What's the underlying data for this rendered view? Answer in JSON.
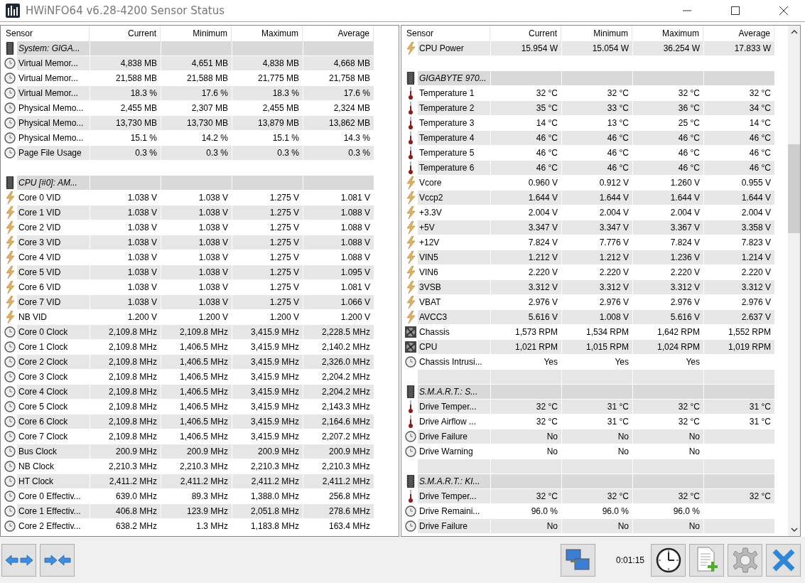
{
  "window": {
    "title": "HWiNFO64 v6.28-4200 Sensor Status"
  },
  "panels": [
    {
      "columns": [
        "Sensor",
        "Current",
        "Minimum",
        "Maximum",
        "Average"
      ],
      "rows": [
        {
          "kind": "group",
          "name": "System: GIGA..."
        },
        {
          "kind": "usage",
          "name": "Virtual Memor...",
          "values": [
            "4,838 MB",
            "4,651 MB",
            "4,838 MB",
            "4,668 MB"
          ],
          "shaded": true
        },
        {
          "kind": "usage",
          "name": "Virtual Memor...",
          "values": [
            "21,588 MB",
            "21,588 MB",
            "21,775 MB",
            "21,758 MB"
          ],
          "shaded": false
        },
        {
          "kind": "usage",
          "name": "Virtual Memor...",
          "values": [
            "18.3 %",
            "17.6 %",
            "18.3 %",
            "17.6 %"
          ],
          "shaded": true
        },
        {
          "kind": "usage",
          "name": "Physical Memo...",
          "values": [
            "2,455 MB",
            "2,307 MB",
            "2,455 MB",
            "2,324 MB"
          ],
          "shaded": false
        },
        {
          "kind": "usage",
          "name": "Physical Memo...",
          "values": [
            "13,730 MB",
            "13,730 MB",
            "13,879 MB",
            "13,862 MB"
          ],
          "shaded": true
        },
        {
          "kind": "usage",
          "name": "Physical Memo...",
          "values": [
            "15.1 %",
            "14.2 %",
            "15.1 %",
            "14.3 %"
          ],
          "shaded": false
        },
        {
          "kind": "usage",
          "name": "Page File Usage",
          "values": [
            "0.3 %",
            "0.3 %",
            "0.3 %",
            "0.3 %"
          ],
          "shaded": true
        },
        {
          "kind": "blank",
          "shaded": false
        },
        {
          "kind": "group",
          "name": "CPU [#0]: AM..."
        },
        {
          "kind": "voltage",
          "name": "Core 0 VID",
          "values": [
            "1.038 V",
            "1.038 V",
            "1.275 V",
            "1.081 V"
          ],
          "shaded": false
        },
        {
          "kind": "voltage",
          "name": "Core 1 VID",
          "values": [
            "1.038 V",
            "1.038 V",
            "1.275 V",
            "1.088 V"
          ],
          "shaded": true
        },
        {
          "kind": "voltage",
          "name": "Core 2 VID",
          "values": [
            "1.038 V",
            "1.038 V",
            "1.275 V",
            "1.088 V"
          ],
          "shaded": false
        },
        {
          "kind": "voltage",
          "name": "Core 3 VID",
          "values": [
            "1.038 V",
            "1.038 V",
            "1.275 V",
            "1.088 V"
          ],
          "shaded": true
        },
        {
          "kind": "voltage",
          "name": "Core 4 VID",
          "values": [
            "1.038 V",
            "1.038 V",
            "1.275 V",
            "1.088 V"
          ],
          "shaded": false
        },
        {
          "kind": "voltage",
          "name": "Core 5 VID",
          "values": [
            "1.038 V",
            "1.038 V",
            "1.275 V",
            "1.095 V"
          ],
          "shaded": true
        },
        {
          "kind": "voltage",
          "name": "Core 6 VID",
          "values": [
            "1.038 V",
            "1.038 V",
            "1.275 V",
            "1.081 V"
          ],
          "shaded": false
        },
        {
          "kind": "voltage",
          "name": "Core 7 VID",
          "values": [
            "1.038 V",
            "1.038 V",
            "1.275 V",
            "1.066 V"
          ],
          "shaded": true
        },
        {
          "kind": "voltage",
          "name": "NB VID",
          "values": [
            "1.200 V",
            "1.200 V",
            "1.200 V",
            "1.200 V"
          ],
          "shaded": false
        },
        {
          "kind": "usage",
          "name": "Core 0 Clock",
          "values": [
            "2,109.8 MHz",
            "2,109.8 MHz",
            "3,415.9 MHz",
            "2,228.5 MHz"
          ],
          "shaded": true
        },
        {
          "kind": "usage",
          "name": "Core 1 Clock",
          "values": [
            "2,109.8 MHz",
            "1,406.5 MHz",
            "3,415.9 MHz",
            "2,140.2 MHz"
          ],
          "shaded": false
        },
        {
          "kind": "usage",
          "name": "Core 2 Clock",
          "values": [
            "2,109.8 MHz",
            "1,406.5 MHz",
            "3,415.9 MHz",
            "2,326.0 MHz"
          ],
          "shaded": true
        },
        {
          "kind": "usage",
          "name": "Core 3 Clock",
          "values": [
            "2,109.8 MHz",
            "1,406.5 MHz",
            "3,415.9 MHz",
            "2,204.2 MHz"
          ],
          "shaded": false
        },
        {
          "kind": "usage",
          "name": "Core 4 Clock",
          "values": [
            "2,109.8 MHz",
            "1,406.5 MHz",
            "3,415.9 MHz",
            "2,204.2 MHz"
          ],
          "shaded": true
        },
        {
          "kind": "usage",
          "name": "Core 5 Clock",
          "values": [
            "2,109.8 MHz",
            "1,406.5 MHz",
            "3,415.9 MHz",
            "2,143.3 MHz"
          ],
          "shaded": false
        },
        {
          "kind": "usage",
          "name": "Core 6 Clock",
          "values": [
            "2,109.8 MHz",
            "1,406.5 MHz",
            "3,415.9 MHz",
            "2,164.6 MHz"
          ],
          "shaded": true
        },
        {
          "kind": "usage",
          "name": "Core 7 Clock",
          "values": [
            "2,109.8 MHz",
            "1,406.5 MHz",
            "3,415.9 MHz",
            "2,207.2 MHz"
          ],
          "shaded": false
        },
        {
          "kind": "usage",
          "name": "Bus Clock",
          "values": [
            "200.9 MHz",
            "200.9 MHz",
            "200.9 MHz",
            "200.9 MHz"
          ],
          "shaded": true
        },
        {
          "kind": "usage",
          "name": "NB Clock",
          "values": [
            "2,210.3 MHz",
            "2,210.3 MHz",
            "2,210.3 MHz",
            "2,210.3 MHz"
          ],
          "shaded": false
        },
        {
          "kind": "usage",
          "name": "HT Clock",
          "values": [
            "2,411.2 MHz",
            "2,411.2 MHz",
            "2,411.2 MHz",
            "2,411.2 MHz"
          ],
          "shaded": true
        },
        {
          "kind": "usage",
          "name": "Core 0 Effectiv...",
          "values": [
            "639.0 MHz",
            "89.3 MHz",
            "1,388.0 MHz",
            "256.8 MHz"
          ],
          "shaded": false
        },
        {
          "kind": "usage",
          "name": "Core 1 Effectiv...",
          "values": [
            "406.8 MHz",
            "123.9 MHz",
            "2,051.8 MHz",
            "278.6 MHz"
          ],
          "shaded": true
        },
        {
          "kind": "usage",
          "name": "Core 2 Effectiv...",
          "values": [
            "638.2 MHz",
            "1.3 MHz",
            "1,183.8 MHz",
            "163.4 MHz"
          ],
          "shaded": false
        }
      ]
    },
    {
      "columns": [
        "Sensor",
        "Current",
        "Minimum",
        "Maximum",
        "Average"
      ],
      "rows": [
        {
          "kind": "voltage",
          "name": "CPU Power",
          "values": [
            "15.954 W",
            "15.054 W",
            "36.254 W",
            "17.833 W"
          ],
          "shaded": true
        },
        {
          "kind": "blank",
          "shaded": false
        },
        {
          "kind": "group",
          "name": "GIGABYTE 970..."
        },
        {
          "kind": "temperature",
          "name": "Temperature 1",
          "values": [
            "32 °C",
            "32 °C",
            "32 °C",
            "32 °C"
          ],
          "shaded": false
        },
        {
          "kind": "temperature",
          "name": "Temperature 2",
          "values": [
            "35 °C",
            "33 °C",
            "36 °C",
            "34 °C"
          ],
          "shaded": true
        },
        {
          "kind": "temperature",
          "name": "Temperature 3",
          "values": [
            "14 °C",
            "13 °C",
            "25 °C",
            "14 °C"
          ],
          "shaded": false
        },
        {
          "kind": "temperature",
          "name": "Temperature 4",
          "values": [
            "46 °C",
            "46 °C",
            "46 °C",
            "46 °C"
          ],
          "shaded": true
        },
        {
          "kind": "temperature",
          "name": "Temperature 5",
          "values": [
            "46 °C",
            "46 °C",
            "46 °C",
            "46 °C"
          ],
          "shaded": false
        },
        {
          "kind": "temperature",
          "name": "Temperature 6",
          "values": [
            "46 °C",
            "46 °C",
            "46 °C",
            "46 °C"
          ],
          "shaded": true
        },
        {
          "kind": "voltage",
          "name": "Vcore",
          "values": [
            "0.960 V",
            "0.912 V",
            "1.260 V",
            "0.955 V"
          ],
          "shaded": false
        },
        {
          "kind": "voltage",
          "name": "Vccp2",
          "values": [
            "1.644 V",
            "1.644 V",
            "1.644 V",
            "1.644 V"
          ],
          "shaded": true
        },
        {
          "kind": "voltage",
          "name": "+3.3V",
          "values": [
            "2.004 V",
            "2.004 V",
            "2.004 V",
            "2.004 V"
          ],
          "shaded": false
        },
        {
          "kind": "voltage",
          "name": "+5V",
          "values": [
            "3.347 V",
            "3.347 V",
            "3.367 V",
            "3.358 V"
          ],
          "shaded": true
        },
        {
          "kind": "voltage",
          "name": "+12V",
          "values": [
            "7.824 V",
            "7.776 V",
            "7.824 V",
            "7.823 V"
          ],
          "shaded": false
        },
        {
          "kind": "voltage",
          "name": "VIN5",
          "values": [
            "1.212 V",
            "1.212 V",
            "1.236 V",
            "1.214 V"
          ],
          "shaded": true
        },
        {
          "kind": "voltage",
          "name": "VIN6",
          "values": [
            "2.220 V",
            "2.220 V",
            "2.220 V",
            "2.220 V"
          ],
          "shaded": false
        },
        {
          "kind": "voltage",
          "name": "3VSB",
          "values": [
            "3.312 V",
            "3.312 V",
            "3.312 V",
            "3.312 V"
          ],
          "shaded": true
        },
        {
          "kind": "voltage",
          "name": "VBAT",
          "values": [
            "2.976 V",
            "2.976 V",
            "2.976 V",
            "2.976 V"
          ],
          "shaded": false
        },
        {
          "kind": "voltage",
          "name": "AVCC3",
          "values": [
            "5.616 V",
            "1.008 V",
            "5.616 V",
            "2.637 V"
          ],
          "shaded": true
        },
        {
          "kind": "fan",
          "name": "Chassis",
          "values": [
            "1,573 RPM",
            "1,534 RPM",
            "1,642 RPM",
            "1,552 RPM"
          ],
          "shaded": false
        },
        {
          "kind": "fan",
          "name": "CPU",
          "values": [
            "1,021 RPM",
            "1,015 RPM",
            "1,024 RPM",
            "1,019 RPM"
          ],
          "shaded": true
        },
        {
          "kind": "usage",
          "name": "Chassis Intrusi...",
          "values": [
            "Yes",
            "Yes",
            "Yes"
          ],
          "shaded": false
        },
        {
          "kind": "blank",
          "shaded": true
        },
        {
          "kind": "group",
          "name": "S.M.A.R.T.: S..."
        },
        {
          "kind": "temperature",
          "name": "Drive Temper...",
          "values": [
            "32 °C",
            "31 °C",
            "32 °C",
            "31 °C"
          ],
          "shaded": true
        },
        {
          "kind": "temperature",
          "name": "Drive Airflow ...",
          "values": [
            "32 °C",
            "31 °C",
            "32 °C",
            "31 °C"
          ],
          "shaded": false
        },
        {
          "kind": "usage",
          "name": "Drive Failure",
          "values": [
            "No",
            "No",
            "No"
          ],
          "shaded": true
        },
        {
          "kind": "usage",
          "name": "Drive Warning",
          "values": [
            "No",
            "No",
            "No"
          ],
          "shaded": false
        },
        {
          "kind": "blank",
          "shaded": true
        },
        {
          "kind": "group",
          "name": "S.M.A.R.T.: KI..."
        },
        {
          "kind": "temperature",
          "name": "Drive Temper...",
          "values": [
            "32 °C",
            "32 °C",
            "32 °C",
            "32 °C"
          ],
          "shaded": true
        },
        {
          "kind": "usage",
          "name": "Drive Remaini...",
          "values": [
            "96.0 %",
            "96.0 %",
            "96.0 %"
          ],
          "shaded": false
        },
        {
          "kind": "usage",
          "name": "Drive Failure",
          "values": [
            "No",
            "No",
            "No"
          ],
          "shaded": true
        }
      ]
    }
  ],
  "toolbar": {
    "elapsed": "0:01:15"
  }
}
